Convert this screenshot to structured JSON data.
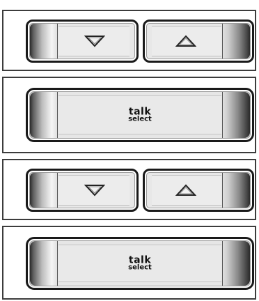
{
  "rows": [
    {
      "type": "rocker",
      "left_icon": "triangle-down-icon",
      "right_icon": "triangle-up-icon"
    },
    {
      "type": "talk",
      "line1": "talk",
      "line2": "select"
    },
    {
      "type": "rocker",
      "left_icon": "triangle-down-icon",
      "right_icon": "triangle-up-icon"
    },
    {
      "type": "talk",
      "line1": "talk",
      "line2": "select"
    }
  ],
  "colors": {
    "outline": "#1a1a1a",
    "face": "#e8e8e8",
    "cap_dark": "#2a2a2a",
    "cap_light": "#f5f5f5",
    "panel_border": "#3c3c3c"
  }
}
